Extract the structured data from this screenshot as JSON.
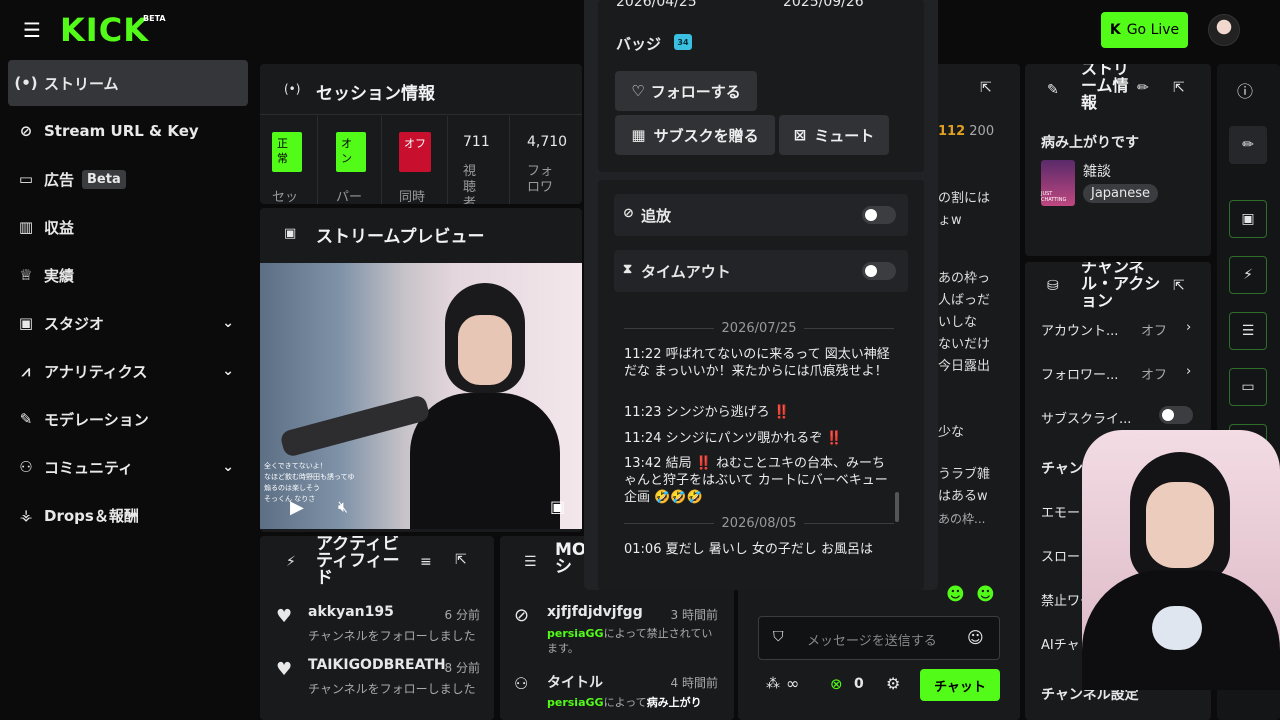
{
  "brand": {
    "logo": "KICK",
    "beta": "BETA",
    "go_live": "Go Live",
    "colors": {
      "accent": "#53fc18",
      "bg": "#0b0b0c",
      "panel": "#181a1c",
      "badge_red": "#c8102e"
    }
  },
  "sidebar": {
    "items": [
      {
        "label": "ストリーム",
        "icon": "stream-icon"
      },
      {
        "label": "Stream URL & Key",
        "icon": "link-icon"
      },
      {
        "label": "広告",
        "badge": "Beta",
        "icon": "ads-icon"
      },
      {
        "label": "収益",
        "icon": "revenue-icon"
      },
      {
        "label": "実績",
        "icon": "trophy-icon"
      },
      {
        "label": "スタジオ",
        "icon": "studio-icon"
      },
      {
        "label": "アナリティクス",
        "icon": "analytics-icon"
      },
      {
        "label": "モデレーション",
        "icon": "wrench-icon"
      },
      {
        "label": "コミュニティ",
        "icon": "community-icon"
      },
      {
        "label": "Drops＆報酬",
        "icon": "drops-icon"
      }
    ]
  },
  "session": {
    "title": "セッション情報",
    "stats": [
      {
        "value": "正常",
        "label": "セッ"
      },
      {
        "value": "オン",
        "label": "パー"
      },
      {
        "value": "オフ",
        "label": "同時"
      },
      {
        "value": "711",
        "label": "視聴者"
      },
      {
        "value": "4,710",
        "label": "フォロワ"
      }
    ]
  },
  "preview": {
    "title": "ストリームプレビュー",
    "overlay_line1": "全くできてないよ！",
    "overlay_line2": "なほど飲む時野田も誘ってゆ",
    "overlay_line3": "煽るのは楽しそう",
    "overlay_line4": "そっくん   なりさ"
  },
  "activity": {
    "title": "アクティビティフィード",
    "items": [
      {
        "name": "akkyan195",
        "time": "6 分前",
        "text": "チャンネルをフォローしました"
      },
      {
        "name": "TAIKIGODBREATH",
        "time": "8 分前",
        "text": "チャンネルをフォローしました"
      }
    ]
  },
  "mod": {
    "title": "MO シ",
    "items": [
      {
        "name": "xjfjfdjdvjfgg",
        "time": "3 時間前",
        "by": "persiaGG",
        "text": "によって禁止されています。"
      },
      {
        "name": "タイトル",
        "time": "4 時間前",
        "by": "persiaGG",
        "text": "によって",
        "bold": "病み上がり"
      }
    ]
  },
  "popup": {
    "date1": "2026/04/25",
    "date2": "2025/09/26",
    "badge_label": "バッジ",
    "badge_num": "34",
    "follow": "フォローする",
    "gift": "サブスクを贈る",
    "mute": "ミュート",
    "ban": "追放",
    "timeout": "タイムアウト",
    "sep1": "2026/07/25",
    "sep2": "2026/08/05",
    "lines": [
      {
        "time": "11:22",
        "text": "呼ばれてないのに来るって 図太い神経だな まっいいか！来たからには爪痕残せよ！"
      },
      {
        "time": "11:23",
        "text": "シンジから逃げろ ‼️"
      },
      {
        "time": "11:24",
        "text": "シンジにパンツ覗かれるぞ ‼️"
      },
      {
        "time": "13:42",
        "text": "結局 ‼️ ねむことユキの台本、みーちゃんと狩子をはぶいて カートにバーベキュー企画 🤣🤣🤣"
      },
      {
        "time": "01:06",
        "text": "夏だし 暑いし 女の子だし お風呂は"
      }
    ]
  },
  "chat": {
    "counts": "112",
    "counts2": "200",
    "frag": [
      "の割には",
      "ょw",
      "あの枠っ",
      "人ばっだ",
      "いしな",
      "ないだけ",
      "今日露出",
      "少な",
      "うラブ雑",
      "はあるw",
      "あの枠..."
    ],
    "placeholder": "メッセージを送信する",
    "infinity": "∞",
    "zero": "0",
    "send": "チャット"
  },
  "streaminfo": {
    "title": "ストリーム情報",
    "stream_title": "病み上がりです",
    "category": "雑談",
    "thumb_label": "JUST CHATTING",
    "language": "Japanese"
  },
  "actions": {
    "title": "チャンネル・アクション",
    "rows": [
      {
        "label": "アカウント...",
        "value": "オフ"
      },
      {
        "label": "フォロワー...",
        "value": "オフ"
      },
      {
        "label": "サブスクライ..."
      }
    ],
    "section": "チャンネル設定",
    "emote": "エモートのみ",
    "slow": "スロー",
    "ban": "禁止ワー",
    "ai": "AIチャ",
    "footer": "チャンネル設定"
  }
}
